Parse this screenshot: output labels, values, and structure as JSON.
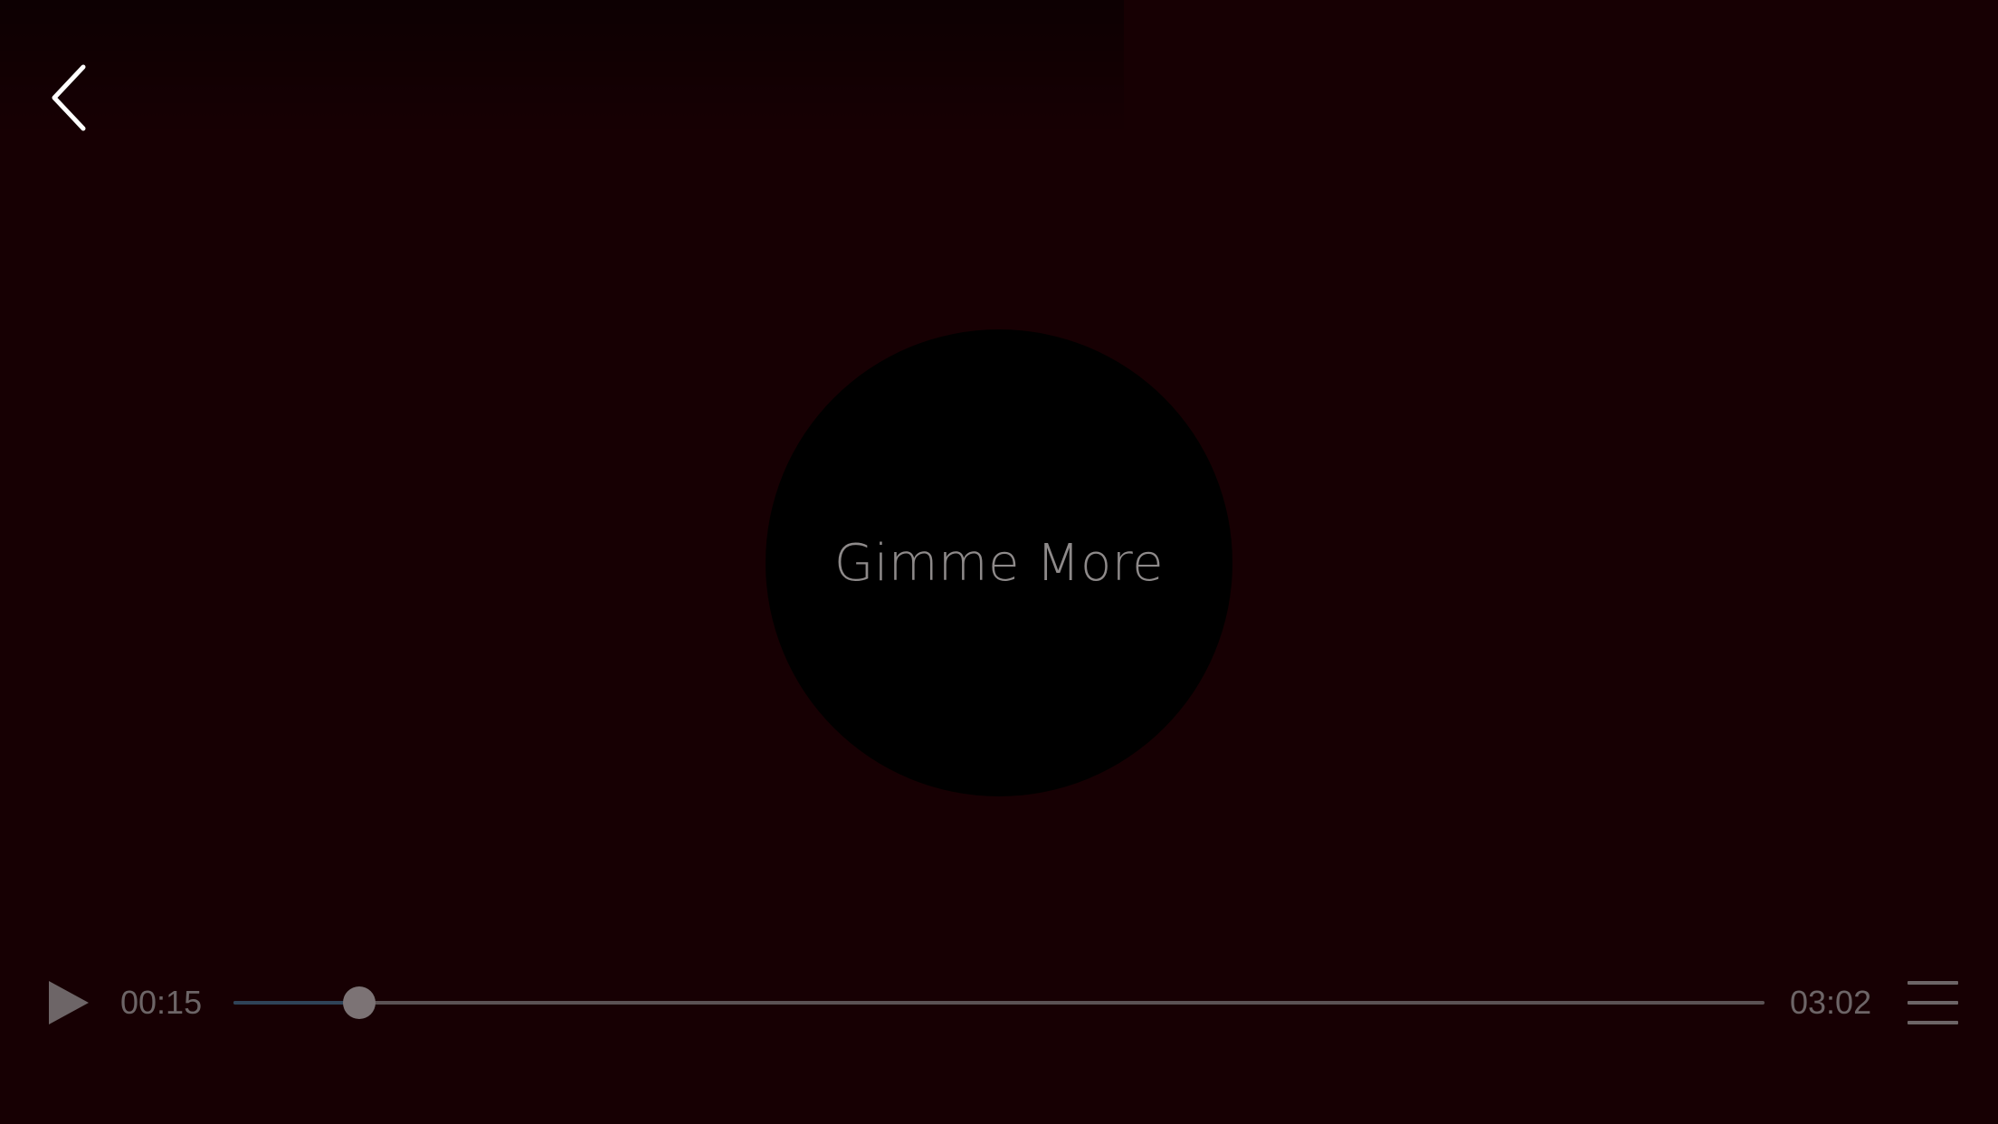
{
  "player": {
    "track_title": "Gimme More",
    "current_time": "00:15",
    "total_time": "03:02",
    "progress_fraction": 0.0824
  },
  "icons": {
    "back": "chevron-left-icon",
    "play": "play-icon",
    "menu": "hamburger-menu-icon"
  },
  "colors": {
    "background": "#170003",
    "disc": "#000000",
    "progress_fill": "#2f4358",
    "progress_track": "#5b5254"
  }
}
